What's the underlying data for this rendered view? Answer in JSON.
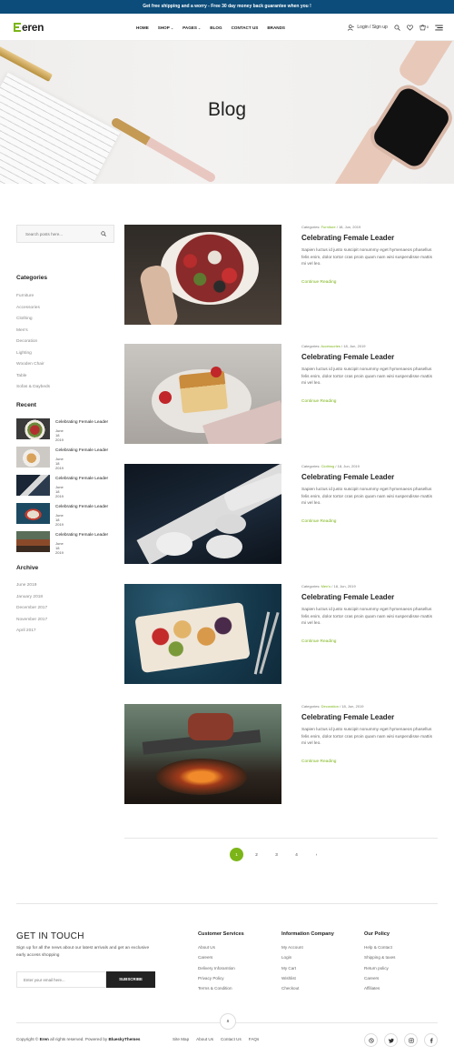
{
  "topbar": {
    "text": "Get free shipping and a worry - Free 30 day money back guarantee when you !"
  },
  "header": {
    "logo": "eren",
    "nav": [
      {
        "label": "HOME",
        "dropdown": false
      },
      {
        "label": "SHOP",
        "dropdown": true
      },
      {
        "label": "PAGES",
        "dropdown": true
      },
      {
        "label": "BLOG",
        "dropdown": false
      },
      {
        "label": "CONTACT US",
        "dropdown": false
      },
      {
        "label": "BRANDS",
        "dropdown": false
      }
    ],
    "login": "Login / Sign up",
    "cart_count": "0"
  },
  "hero": {
    "title": "Blog"
  },
  "sidebar": {
    "search_placeholder": "Search posts here...",
    "categories_title": "Categories",
    "categories": [
      "Furniture",
      "Accessories",
      "Clothing",
      "Men's",
      "Decoration",
      "Lighting",
      "Wooden Chair",
      "Table",
      "Sofas & Daybeds"
    ],
    "recent_title": "Recent",
    "recent": [
      {
        "title": "Celebrating Female Leader",
        "date": "June 18 2019"
      },
      {
        "title": "Celebrating Female Leader",
        "date": "June 18 2019"
      },
      {
        "title": "Celebrating Female Leader",
        "date": "June 18 2019"
      },
      {
        "title": "Celebrating Female Leader",
        "date": "June 18 2019"
      },
      {
        "title": "Celebrating Female Leader",
        "date": "June 18 2019"
      }
    ],
    "archive_title": "Archive",
    "archive": [
      "June 2019",
      "January 2018",
      "December 2017",
      "November 2017",
      "April 2017"
    ]
  },
  "posts": [
    {
      "meta_prefix": "Categories:",
      "category": "Furniture",
      "date": "/ 18, Jun, 2019",
      "title": "Celebrating Female Leader",
      "excerpt": "Sapien luctus id justo suscipit nonummy eget hymenaeos phasellus felis enim, dolor tortor cras proin quam nam wisi suspendisse mattis mi vel leo.",
      "more": "Continue Reading"
    },
    {
      "meta_prefix": "Categories:",
      "category": "Accessories",
      "date": "/ 18, Jun, 2019",
      "title": "Celebrating Female Leader",
      "excerpt": "Sapien luctus id justo suscipit nonummy eget hymenaeos phasellus felis enim, dolor tortor cras proin quam nam wisi suspendisse mattis mi vel leo.",
      "more": "Continue Reading"
    },
    {
      "meta_prefix": "Categories:",
      "category": "Clothing",
      "date": "/ 18, Jun, 2019",
      "title": "Celebrating Female Leader",
      "excerpt": "Sapien luctus id justo suscipit nonummy eget hymenaeos phasellus felis enim, dolor tortor cras proin quam nam wisi suspendisse mattis mi vel leo.",
      "more": "Continue Reading"
    },
    {
      "meta_prefix": "Categories:",
      "category": "Men's",
      "date": "/ 18, Jun, 2019",
      "title": "Celebrating Female Leader",
      "excerpt": "Sapien luctus id justo suscipit nonummy eget hymenaeos phasellus felis enim, dolor tortor cras proin quam nam wisi suspendisse mattis mi vel leo.",
      "more": "Continue Reading"
    },
    {
      "meta_prefix": "Categories:",
      "category": "Decoration",
      "date": "/ 18, Jun, 2019",
      "title": "Celebrating Female Leader",
      "excerpt": "Sapien luctus id justo suscipit nonummy eget hymenaeos phasellus felis enim, dolor tortor cras proin quam nam wisi suspendisse mattis mi vel leo.",
      "more": "Continue Reading"
    }
  ],
  "pagination": {
    "pages": [
      "1",
      "2",
      "3",
      "4"
    ],
    "active": "1",
    "next": "›"
  },
  "footer": {
    "title": "GET IN TOUCH",
    "text": "Sign up for all the news about our latest arrivals and get an exclusive early access shopping",
    "email_placeholder": "Enter your email here...",
    "subscribe": "SUBSCRIBE",
    "columns": [
      {
        "title": "Customer Services",
        "links": [
          "About Us",
          "Careers",
          "Delivery Inforamtion",
          "Privacy Policy",
          "Terms & Condition"
        ]
      },
      {
        "title": "Information Company",
        "links": [
          "My Account",
          "Login",
          "My Cart",
          "Wishlist",
          "Checkout"
        ]
      },
      {
        "title": "Our Policy",
        "links": [
          "Help & Contact",
          "Shipping & taxes",
          "Return policy",
          "Careers",
          "Affiliates"
        ]
      }
    ],
    "back_top": "∧",
    "copyright_prefix": "Copyright ©",
    "copyright_brand": "Eren",
    "copyright_mid": "all rights reserved. Powered by",
    "copyright_theme": "BlueskyThemes",
    "bottom_links": [
      "Site Map",
      "About Us",
      "Contact Us",
      "FAQs"
    ],
    "socials": [
      "dribbble-icon",
      "twitter-icon",
      "instagram-icon",
      "facebook-icon"
    ]
  },
  "colors": {
    "accent": "#7cb518",
    "topbar": "#0b4c7a",
    "dark": "#222222"
  }
}
